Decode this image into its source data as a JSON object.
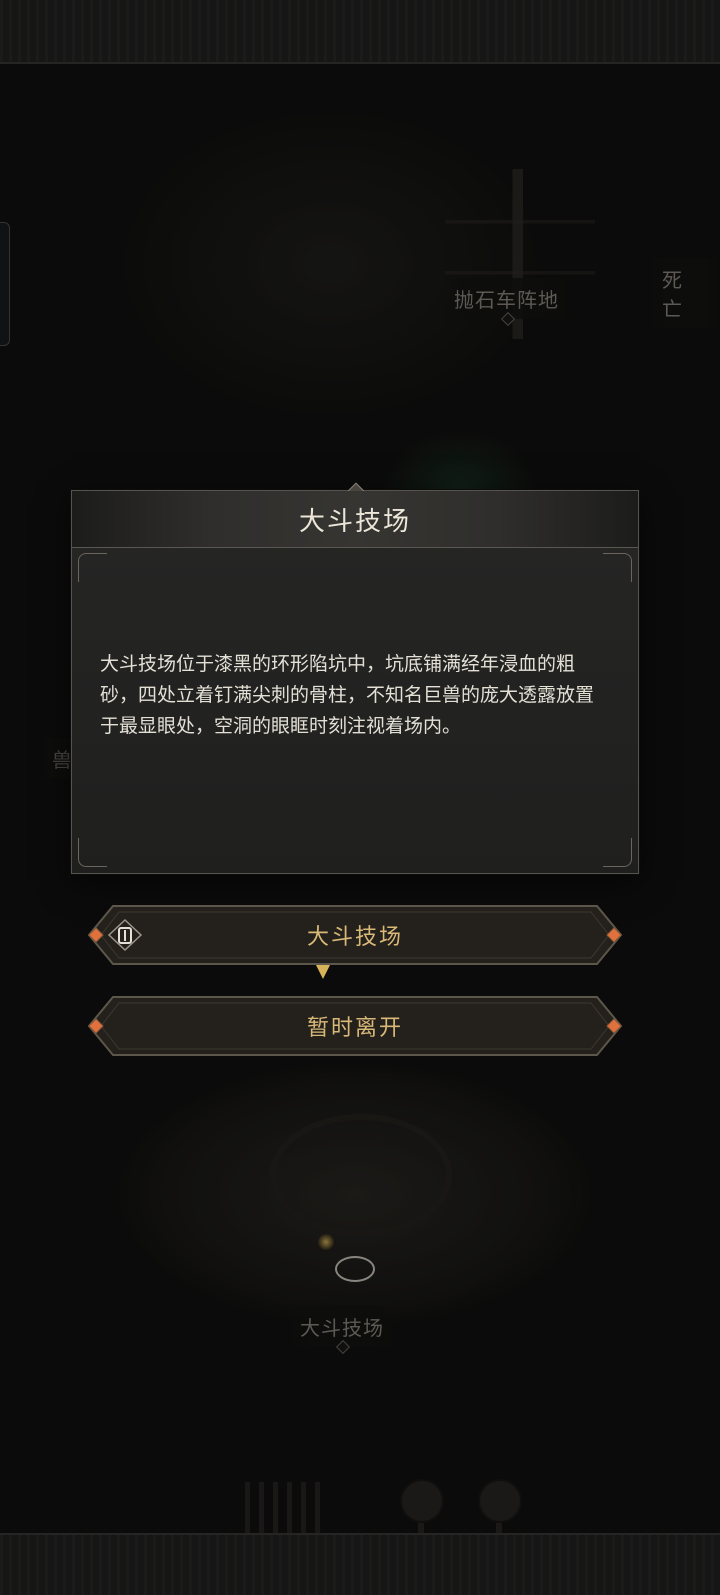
{
  "map": {
    "labels": {
      "catapult": "抛石车阵地",
      "death": "死亡",
      "beast": "兽",
      "arena": "大斗技场"
    }
  },
  "dialog": {
    "title": "大斗技场",
    "description": "大斗技场位于漆黑的环形陷坑中，坑底铺满经年浸血的粗砂，四处立着钉满尖刺的骨柱，不知名巨兽的庞大透露放置于最显眼处，空洞的眼眶时刻注视着场内。"
  },
  "actions": {
    "enter_label": "大斗技场",
    "enter_icon": "lantern-icon",
    "leave_label": "暂时离开"
  },
  "colors": {
    "accent_gold": "#d9b978",
    "ember": "#e0703c"
  }
}
